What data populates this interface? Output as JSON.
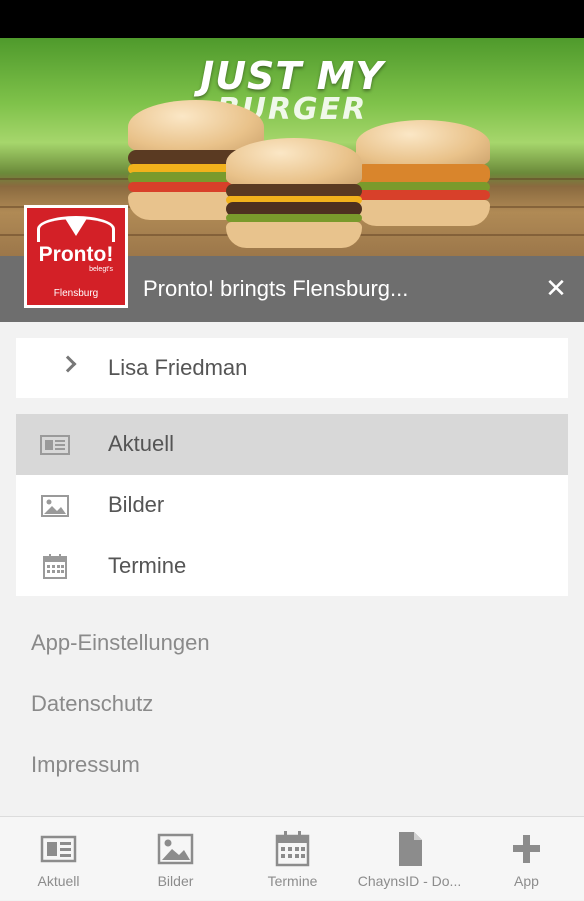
{
  "banner": {
    "headline_line1": "JUST MY",
    "headline_line2": "BURGER"
  },
  "logo": {
    "name": "Pronto!",
    "tagline": "belegt's",
    "city": "Flensburg"
  },
  "header": {
    "title": "Pronto! bringts Flensburg...",
    "close_icon": "close-icon"
  },
  "user": {
    "name": "Lisa Friedman",
    "icon": "chevron-right-icon"
  },
  "menu": {
    "items": [
      {
        "label": "Aktuell",
        "icon": "newspaper-icon",
        "active": true
      },
      {
        "label": "Bilder",
        "icon": "image-icon",
        "active": false
      },
      {
        "label": "Termine",
        "icon": "calendar-icon",
        "active": false
      }
    ]
  },
  "links": {
    "items": [
      {
        "label": "App-Einstellungen"
      },
      {
        "label": "Datenschutz"
      },
      {
        "label": "Impressum"
      }
    ]
  },
  "bottom_nav": {
    "items": [
      {
        "label": "Aktuell",
        "icon": "newspaper-icon"
      },
      {
        "label": "Bilder",
        "icon": "image-icon"
      },
      {
        "label": "Termine",
        "icon": "calendar-icon"
      },
      {
        "label": "ChaynsID - Do...",
        "icon": "document-icon"
      },
      {
        "label": "App",
        "icon": "plus-icon"
      }
    ]
  },
  "colors": {
    "header_bar": "#6e6e6e",
    "logo_red": "#d32027",
    "active_row": "#d8d8d8",
    "background": "#f2f2f2"
  }
}
